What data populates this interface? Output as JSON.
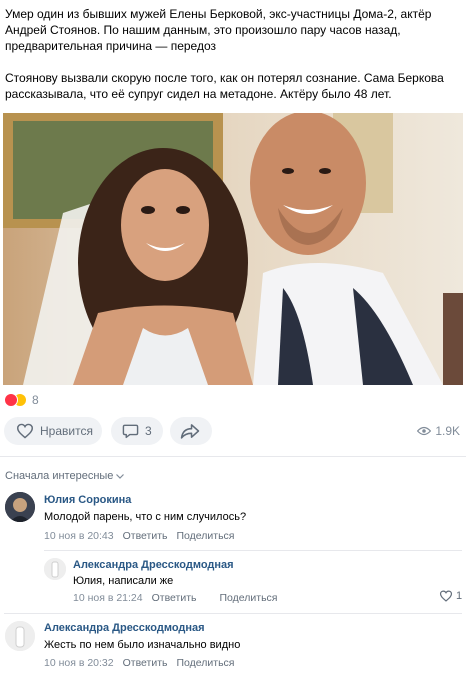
{
  "post": {
    "paragraphs": [
      "Умер один из бывших мужей Елены Берковой, экс-участницы Дома-2, актёр Андрей Стоянов. По нашим данным, это произошло пару часов назад, предварительная причина — передоз",
      "Стоянову вызвали скорую после того, как он потерял сознание. Сама Беркова рассказывала, что её супруг сидел на метадоне. Актёру было 48 лет."
    ]
  },
  "reactions": {
    "count": "8",
    "icons": [
      "heart-reaction",
      "sad-reaction"
    ]
  },
  "actions": {
    "like_label": "Нравится",
    "comments_count": "3",
    "views": "1.9K"
  },
  "comments_sort": {
    "label": "Сначала интересные"
  },
  "colors": {
    "link": "#2a5885",
    "muted": "#818c99",
    "pill_bg": "#f0f2f5"
  },
  "comments": [
    {
      "author": "Юлия Сорокина",
      "text": "Молодой парень, что с ним случилось?",
      "date": "10 ноя в 20:43",
      "reply_label": "Ответить",
      "share_label": "Поделиться"
    },
    {
      "author": "Александра Дресскодмодная",
      "text": "Юлия, написали же",
      "date": "10 ноя в 21:24",
      "reply_label": "Ответить",
      "share_label": "Поделиться",
      "likes": "1"
    },
    {
      "author": "Александра Дресскодмодная",
      "text": "Жесть по нем было изначально видно",
      "date": "10 ноя в 20:32",
      "reply_label": "Ответить",
      "share_label": "Поделиться"
    }
  ]
}
